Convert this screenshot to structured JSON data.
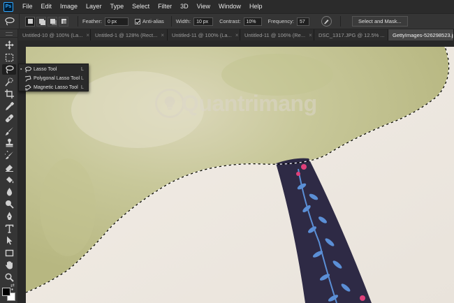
{
  "menu": {
    "logo": "Ps",
    "items": [
      "File",
      "Edit",
      "Image",
      "Layer",
      "Type",
      "Select",
      "Filter",
      "3D",
      "View",
      "Window",
      "Help"
    ]
  },
  "options": {
    "feather_label": "Feather:",
    "feather_value": "0 px",
    "antialias_label": "Anti-alias",
    "width_label": "Width:",
    "width_value": "10 px",
    "contrast_label": "Contrast:",
    "contrast_value": "10%",
    "frequency_label": "Frequency:",
    "frequency_value": "57",
    "select_mask_label": "Select and Mask..."
  },
  "tabs": [
    {
      "label": "Untitled-10 @ 100% (La...",
      "active": false
    },
    {
      "label": "Untitled-1 @ 128% (Rect...",
      "active": false
    },
    {
      "label": "Untitled-11 @ 100% (La...",
      "active": false
    },
    {
      "label": "Untitled-11 @ 106% (Re...",
      "active": false
    },
    {
      "label": "DSC_1317.JPG @ 12.5% ...",
      "active": false
    },
    {
      "label": "GettyImages-526298523.jpg",
      "active": true
    }
  ],
  "tab_close_glyph": "×",
  "flyout": {
    "items": [
      {
        "label": "Lasso Tool",
        "key": "L",
        "selected": true,
        "icon": "lasso-icon"
      },
      {
        "label": "Polygonal Lasso Tool",
        "key": "L",
        "selected": false,
        "icon": "polygonal-lasso-icon"
      },
      {
        "label": "Magnetic Lasso Tool",
        "key": "L",
        "selected": false,
        "icon": "magnetic-lasso-icon"
      }
    ]
  },
  "watermark": "Quantrimang",
  "tools": [
    "move-icon",
    "marquee-icon",
    "lasso-icon",
    "quick-select-icon",
    "crop-icon",
    "eyedropper-icon",
    "healing-brush-icon",
    "brush-icon",
    "clone-stamp-icon",
    "history-brush-icon",
    "eraser-icon",
    "paint-bucket-icon",
    "blur-icon",
    "dodge-icon",
    "pen-icon",
    "type-icon",
    "path-select-icon",
    "rectangle-icon",
    "hand-icon",
    "zoom-icon",
    "more-icon"
  ],
  "colors": {
    "foreground": "#000000",
    "background": "#ffffff",
    "accent": "#31a8ff",
    "strap": "#2e2a45",
    "leaf": "#5b8fd6",
    "flower": "#e0407a"
  }
}
